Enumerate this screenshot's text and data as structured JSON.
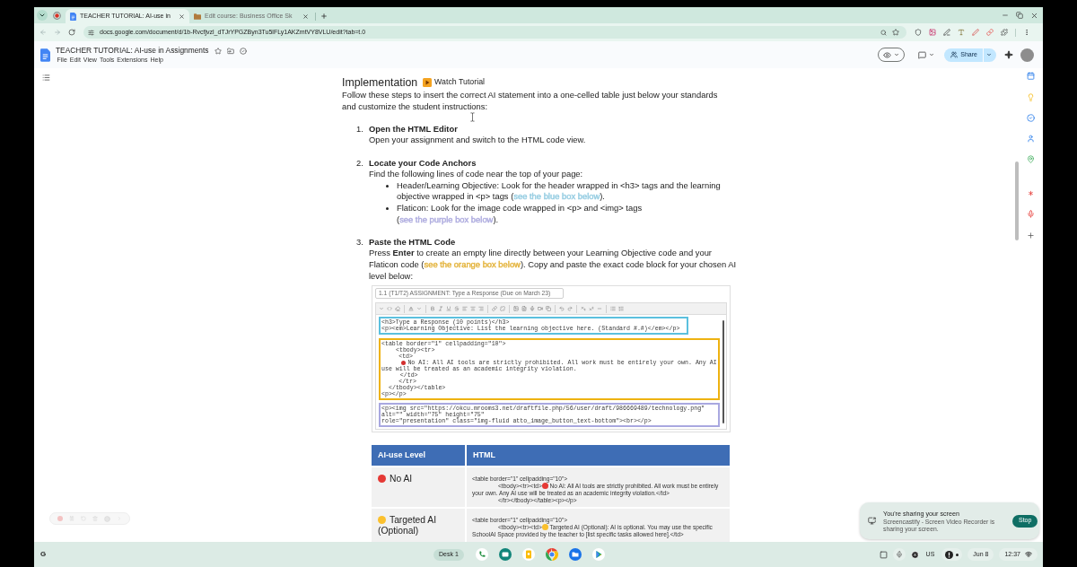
{
  "browser": {
    "tabs": [
      {
        "kind": "docs",
        "title": "TEACHER TUTORIAL: AI-use in",
        "selected": true
      },
      {
        "kind": "course",
        "title": "Edit course: Business Office Sk",
        "selected": false
      }
    ],
    "address": "docs.google.com/document/d/1b-Rvcfjvzl_dTJrYPGZByn3Tu5lFLy1AKZmtVY8VLU/edit?tab=t.0"
  },
  "docs_header": {
    "title": "TEACHER TUTORIAL: AI-use in Assignments",
    "menu": [
      "File",
      "Edit",
      "View",
      "Tools",
      "Extensions",
      "Help"
    ],
    "share": "Share"
  },
  "document": {
    "heading": "Implementation",
    "tutorial_link": "Watch Tutorial",
    "intro": "Follow these steps to insert the correct AI statement into a one-celled table just below your standards and customize the student instructions:",
    "steps": [
      {
        "number": "1.",
        "title": "Open the HTML Editor",
        "body": [
          {
            "kind": "text",
            "text": "Open your assignment and switch to the HTML code view."
          }
        ]
      },
      {
        "number": "2.",
        "title": "Locate your Code Anchors",
        "body": [
          {
            "kind": "text",
            "text": "Find the following lines of code near the top of your page:"
          }
        ],
        "bullets": [
          {
            "segments": [
              {
                "kind": "text",
                "text": "Header/Learning Objective: Look for the header wrapped in <h3> tags and the learning objective wrapped in <p> tags ("
              },
              {
                "kind": "link",
                "text": "see the blue box below",
                "color": "#96cde2"
              },
              {
                "kind": "text",
                "text": ")."
              }
            ]
          },
          {
            "segments": [
              {
                "kind": "text",
                "text": "Flaticon: Look for the image code wrapped in <p> and <img> tags ("
              },
              {
                "kind": "link",
                "text": "see the purple box below",
                "color": "#aeacdf"
              },
              {
                "kind": "text",
                "text": ")."
              }
            ]
          }
        ]
      },
      {
        "number": "3.",
        "title": "Paste the HTML Code",
        "body": [
          {
            "kind": "text",
            "text": "Press **Enter** to create an empty line directly between your Learning Objective code and your Flaticon code ("
          },
          {
            "kind": "link",
            "text": "see the orange box below",
            "color": "#e4b43e"
          },
          {
            "kind": "text",
            "text": "). Copy and paste the exact code block for your chosen AI level below:"
          }
        ]
      }
    ]
  },
  "lms_screenshot": {
    "title_field": "1.1 (T1/T2) ASSIGNMENT: Type a Response (Due on March 23)",
    "code_blocks": [
      {
        "color": "#5bc0de",
        "lines": [
          {
            "kind": "code",
            "text": "<h3>Type a Response (10 points)</h3>"
          },
          {
            "kind": "code",
            "text": "<p><em>Learning Objective: List the learning objective here. (Standard #.#)</em></p>"
          }
        ]
      },
      {
        "color": "#eeb211",
        "lines": [
          {
            "kind": "code",
            "text": "<table border=\"1\" cellpadding=\"10\">"
          },
          {
            "kind": "code",
            "text": "                    <tbody><tr>"
          },
          {
            "kind": "code",
            "text": "                        <td>"
          },
          {
            "kind": "dot",
            "color": "#d32f2f",
            "text": "                            No AI: All AI tools are strictly prohibited. All work must be entirely your own. Any AI"
          },
          {
            "kind": "code",
            "text": "use will be treated as an academic integrity violation."
          },
          {
            "kind": "code",
            "text": "                          </td>"
          },
          {
            "kind": "code",
            "text": "                        </tr>"
          },
          {
            "kind": "code",
            "text": "          </tbody></table>"
          },
          {
            "kind": "code",
            "text": "<p></p>"
          }
        ]
      },
      {
        "color": "#a9a8e0",
        "lines": [
          {
            "kind": "code",
            "text": "<p><img src=\"https://okcu.mrooms3.net/draftfile.php/56/user/draft/986669489/technology.png\" alt=\"\" width=\"75\" height=\"75\""
          },
          {
            "kind": "code",
            "text": "role=\"presentation\" class=\"img-fluid atto_image_button_text-bottom\"><br></p>"
          }
        ]
      }
    ]
  },
  "ai_table": {
    "columns": [
      "AI-use Level",
      "HTML"
    ],
    "rows": [
      {
        "label": "No AI",
        "color": "#e53935",
        "html_lines": [
          {
            "kind": "plain",
            "text": "<table border=\"1\" cellpadding=\"10\">"
          },
          {
            "kind": "dot_indented",
            "before": "<tbody><tr><td>",
            "text": " No AI: All AI tools are strictly prohibited. All work must be entirely your own. Any AI use will be treated as an academic integrity violation.</td>"
          },
          {
            "kind": "indented",
            "text": "</tr></tbody></table><p></p>"
          }
        ]
      },
      {
        "label": "Targeted AI (Optional)",
        "color": "#fbc02d",
        "html_lines": [
          {
            "kind": "plain",
            "text": "<table border=\"1\" cellpadding=\"10\">"
          },
          {
            "kind": "dot_indented",
            "before": "<tbody><tr><td>",
            "text": " Targeted AI (Optional): AI is optional. You may use the specific SchoolAI Space provided by the teacher to [list specific tasks allowed here].</td>"
          }
        ]
      }
    ]
  },
  "notification": {
    "title": "You're sharing your screen",
    "message": "Screencastify - Screen Video Recorder is sharing your screen.",
    "button": "Stop"
  },
  "taskbar": {
    "launcher": "G",
    "desk": "Desk 1",
    "keyboard": "US",
    "date": "Jun 8",
    "time": "12:37"
  }
}
